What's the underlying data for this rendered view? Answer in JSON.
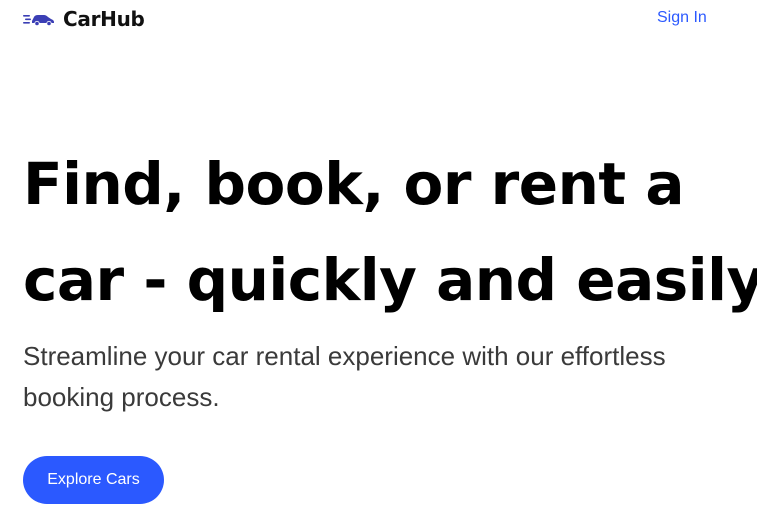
{
  "navbar": {
    "brand_name": "CarHub",
    "brand_icon": "car-speed-icon",
    "signin_label": "Sign In"
  },
  "hero": {
    "title_line1": "Find, book, or rent a",
    "title_line2": "car - quickly and easily",
    "subtitle_line1": "Streamline your car rental experience with our effortless",
    "subtitle_line2": "booking process.",
    "cta_label": "Explore Cars"
  },
  "colors": {
    "accent": "#2b59ff",
    "brand_icon": "#3b3fb5",
    "title_text": "#000000",
    "subtitle_text": "#3a3a3a"
  }
}
